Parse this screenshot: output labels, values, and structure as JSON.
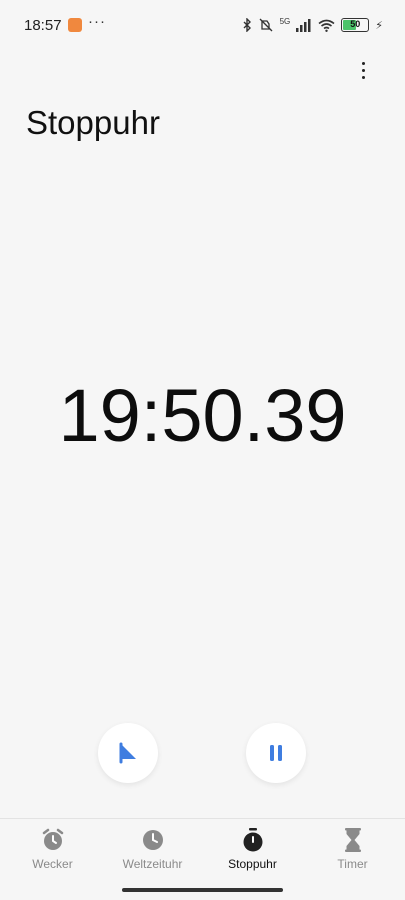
{
  "status_bar": {
    "time": "18:57",
    "overflow": "···",
    "network_label": "5G",
    "battery_level": "50",
    "icons": [
      "app-notification-icon",
      "bluetooth-icon",
      "mute-icon",
      "signal-icon",
      "wifi-icon",
      "battery-icon",
      "charging-icon"
    ]
  },
  "header": {
    "title": "Stoppuhr",
    "menu_icon": "more-vertical-icon"
  },
  "stopwatch": {
    "elapsed": "19:50.39",
    "lap_icon": "flag-icon",
    "pause_icon": "pause-icon",
    "accent_color": "#3f7de0"
  },
  "nav": {
    "items": [
      {
        "label": "Wecker",
        "icon": "alarm-icon",
        "active": false
      },
      {
        "label": "Weltzeituhr",
        "icon": "clock-icon",
        "active": false
      },
      {
        "label": "Stoppuhr",
        "icon": "stopwatch-icon",
        "active": true
      },
      {
        "label": "Timer",
        "icon": "hourglass-icon",
        "active": false
      }
    ]
  }
}
